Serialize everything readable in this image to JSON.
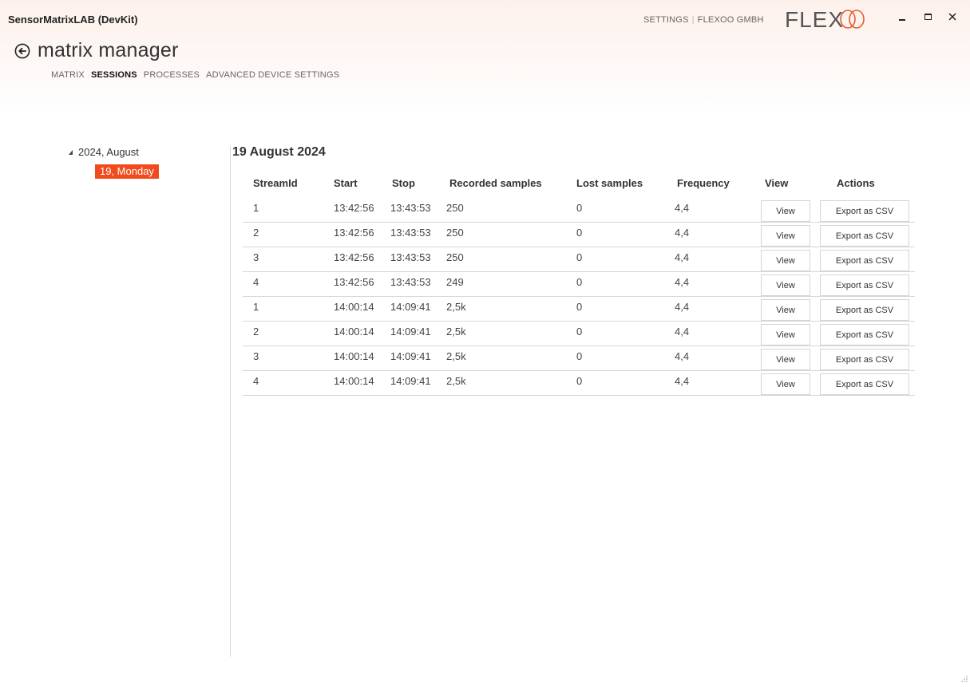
{
  "window": {
    "title": "SensorMatrixLAB (DevKit)",
    "top_links": {
      "settings": "SETTINGS",
      "company": "FLEXOO GMBH"
    },
    "logo_text": "FLEX",
    "controls": {
      "minimize": "minimize-icon",
      "maximize": "maximize-icon",
      "close": "close-icon"
    }
  },
  "header": {
    "title": "matrix manager",
    "back_icon": "arrow-left-circle-icon",
    "tabs": [
      {
        "label": "MATRIX",
        "active": false
      },
      {
        "label": "SESSIONS",
        "active": true
      },
      {
        "label": "PROCESSES",
        "active": false
      },
      {
        "label": "ADVANCED DEVICE SETTINGS",
        "active": false
      }
    ]
  },
  "tree": {
    "root_label": "2024, August",
    "selected_child": "19, Monday"
  },
  "accent_color": "#f04a1d",
  "sessions": {
    "heading": "19 August 2024",
    "columns": {
      "stream_id": "StreamId",
      "start": "Start",
      "stop": "Stop",
      "recorded": "Recorded samples",
      "lost": "Lost samples",
      "frequency": "Frequency",
      "view": "View",
      "actions": "Actions"
    },
    "rows": [
      {
        "stream_id": "1",
        "start": "13:42:56",
        "stop": "13:43:53",
        "recorded": "250",
        "lost": "0",
        "frequency": "4,4",
        "view_label": "View",
        "export_label": "Export as CSV"
      },
      {
        "stream_id": "2",
        "start": "13:42:56",
        "stop": "13:43:53",
        "recorded": "250",
        "lost": "0",
        "frequency": "4,4",
        "view_label": "View",
        "export_label": "Export as CSV"
      },
      {
        "stream_id": "3",
        "start": "13:42:56",
        "stop": "13:43:53",
        "recorded": "250",
        "lost": "0",
        "frequency": "4,4",
        "view_label": "View",
        "export_label": "Export as CSV"
      },
      {
        "stream_id": "4",
        "start": "13:42:56",
        "stop": "13:43:53",
        "recorded": "249",
        "lost": "0",
        "frequency": "4,4",
        "view_label": "View",
        "export_label": "Export as CSV"
      },
      {
        "stream_id": "1",
        "start": "14:00:14",
        "stop": "14:09:41",
        "recorded": "2,5k",
        "lost": "0",
        "frequency": "4,4",
        "view_label": "View",
        "export_label": "Export as CSV"
      },
      {
        "stream_id": "2",
        "start": "14:00:14",
        "stop": "14:09:41",
        "recorded": "2,5k",
        "lost": "0",
        "frequency": "4,4",
        "view_label": "View",
        "export_label": "Export as CSV"
      },
      {
        "stream_id": "3",
        "start": "14:00:14",
        "stop": "14:09:41",
        "recorded": "2,5k",
        "lost": "0",
        "frequency": "4,4",
        "view_label": "View",
        "export_label": "Export as CSV"
      },
      {
        "stream_id": "4",
        "start": "14:00:14",
        "stop": "14:09:41",
        "recorded": "2,5k",
        "lost": "0",
        "frequency": "4,4",
        "view_label": "View",
        "export_label": "Export as CSV"
      }
    ]
  }
}
